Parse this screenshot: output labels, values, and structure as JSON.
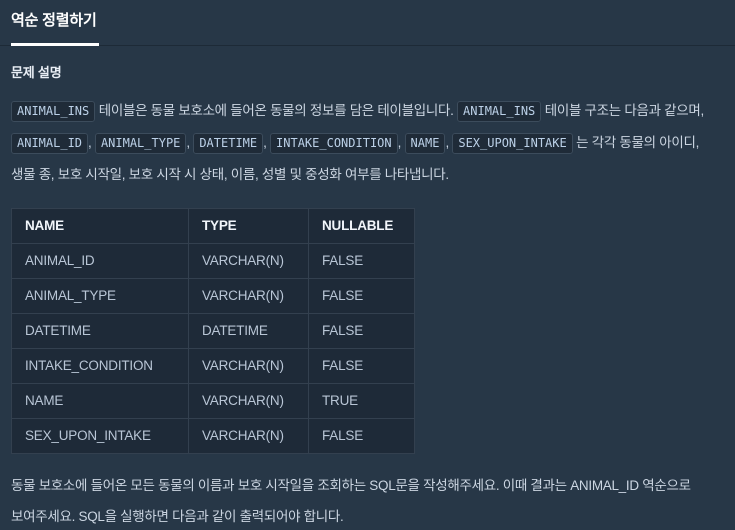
{
  "tab": {
    "label": "역순 정렬하기"
  },
  "section": {
    "heading": "문제 설명"
  },
  "description": {
    "line1_code1": "ANIMAL_INS",
    "line1_text1": "테이블은 동물 보호소에 들어온 동물의 정보를 담은 테이블입니다.",
    "line1_code2": "ANIMAL_INS",
    "line1_text2": "테이블 구조는 다음과 같으며,",
    "col1": "ANIMAL_ID",
    "sep1": ",",
    "col2": "ANIMAL_TYPE",
    "sep2": ",",
    "col3": "DATETIME",
    "sep3": ",",
    "col4": "INTAKE_CONDITION",
    "sep4": ",",
    "col5": "NAME",
    "sep5": ",",
    "col6": "SEX_UPON_INTAKE",
    "line3_text": "는 각각 동물의 아이디, 생물 종, 보호 시작일, 보호 시작 시 상태, 이름, 성별 및 중성화 여부를 나타냅니다."
  },
  "table": {
    "columns": [
      "NAME",
      "TYPE",
      "NULLABLE"
    ],
    "rows": [
      [
        "ANIMAL_ID",
        "VARCHAR(N)",
        "FALSE"
      ],
      [
        "ANIMAL_TYPE",
        "VARCHAR(N)",
        "FALSE"
      ],
      [
        "DATETIME",
        "DATETIME",
        "FALSE"
      ],
      [
        "INTAKE_CONDITION",
        "VARCHAR(N)",
        "FALSE"
      ],
      [
        "NAME",
        "VARCHAR(N)",
        "TRUE"
      ],
      [
        "SEX_UPON_INTAKE",
        "VARCHAR(N)",
        "FALSE"
      ]
    ]
  },
  "footer": {
    "text": "동물 보호소에 들어온 모든 동물의 이름과 보호 시작일을 조회하는 SQL문을 작성해주세요. 이때 결과는 ANIMAL_ID 역순으로 보여주세요. SQL을 실행하면 다음과 같이 출력되어야 합니다."
  },
  "colors": {
    "page_bg": "#273747",
    "table_bg": "#1e2a38",
    "code_bg": "#1f2b38",
    "code_border": "#3c4c5c",
    "accent": "#ffffff",
    "body_text": "#ccd6e2"
  }
}
